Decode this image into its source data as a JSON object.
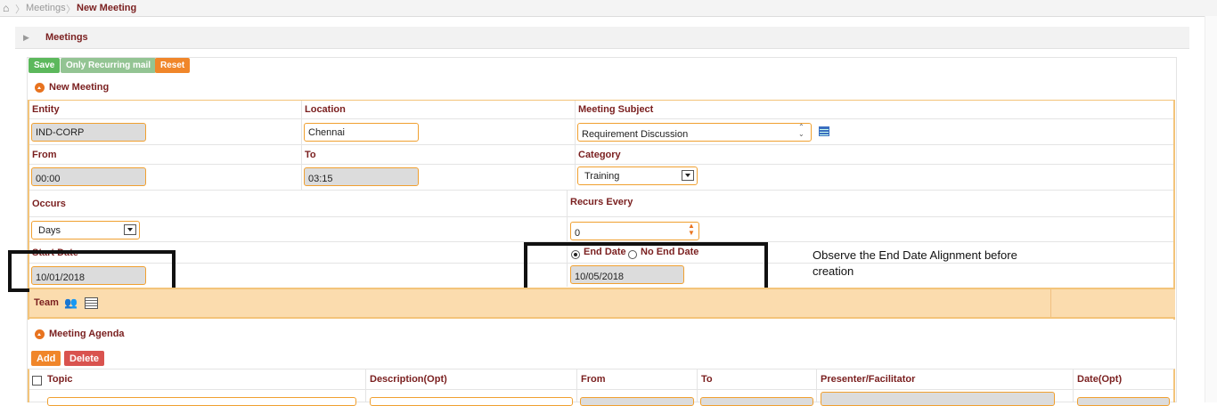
{
  "breadcrumb": {
    "home_icon": "home-icon",
    "item1": "Meetings",
    "item2": "New Meeting"
  },
  "panel_title": "Meetings",
  "toolbar": {
    "save": "Save",
    "only_recurring": "Only Recurring mail",
    "reset": "Reset"
  },
  "section_new": "New Meeting",
  "fields": {
    "entity_label": "Entity",
    "entity_value": "IND-CORP",
    "location_label": "Location",
    "location_value": "Chennai",
    "subject_label": "Meeting Subject",
    "subject_value": "Requirement Discussion",
    "from_label": "From",
    "from_value": "00:00",
    "to_label": "To",
    "to_value": "03:15",
    "category_label": "Category",
    "category_value": "Training",
    "occurs_label": "Occurs",
    "occurs_value": "Days",
    "recurs_label": "Recurs Every",
    "recurs_value": "0",
    "start_label": "Start Date",
    "start_value": "10/01/2018",
    "end_radio": "End Date",
    "noend_radio": "No End Date",
    "end_value": "10/05/2018"
  },
  "annotation": "Observe the End Date Alignment before creation",
  "team_label": "Team",
  "section_agenda": "Meeting Agenda",
  "agenda_buttons": {
    "add": "Add",
    "delete": "Delete"
  },
  "agenda_columns": [
    "Topic",
    "Description(Opt)",
    "From",
    "To",
    "Presenter/Facilitator",
    "Date(Opt)"
  ],
  "colors": {
    "accent": "#e8731f",
    "label": "#7a1f1f",
    "save": "#5cb85c",
    "delete": "#d9534f"
  }
}
